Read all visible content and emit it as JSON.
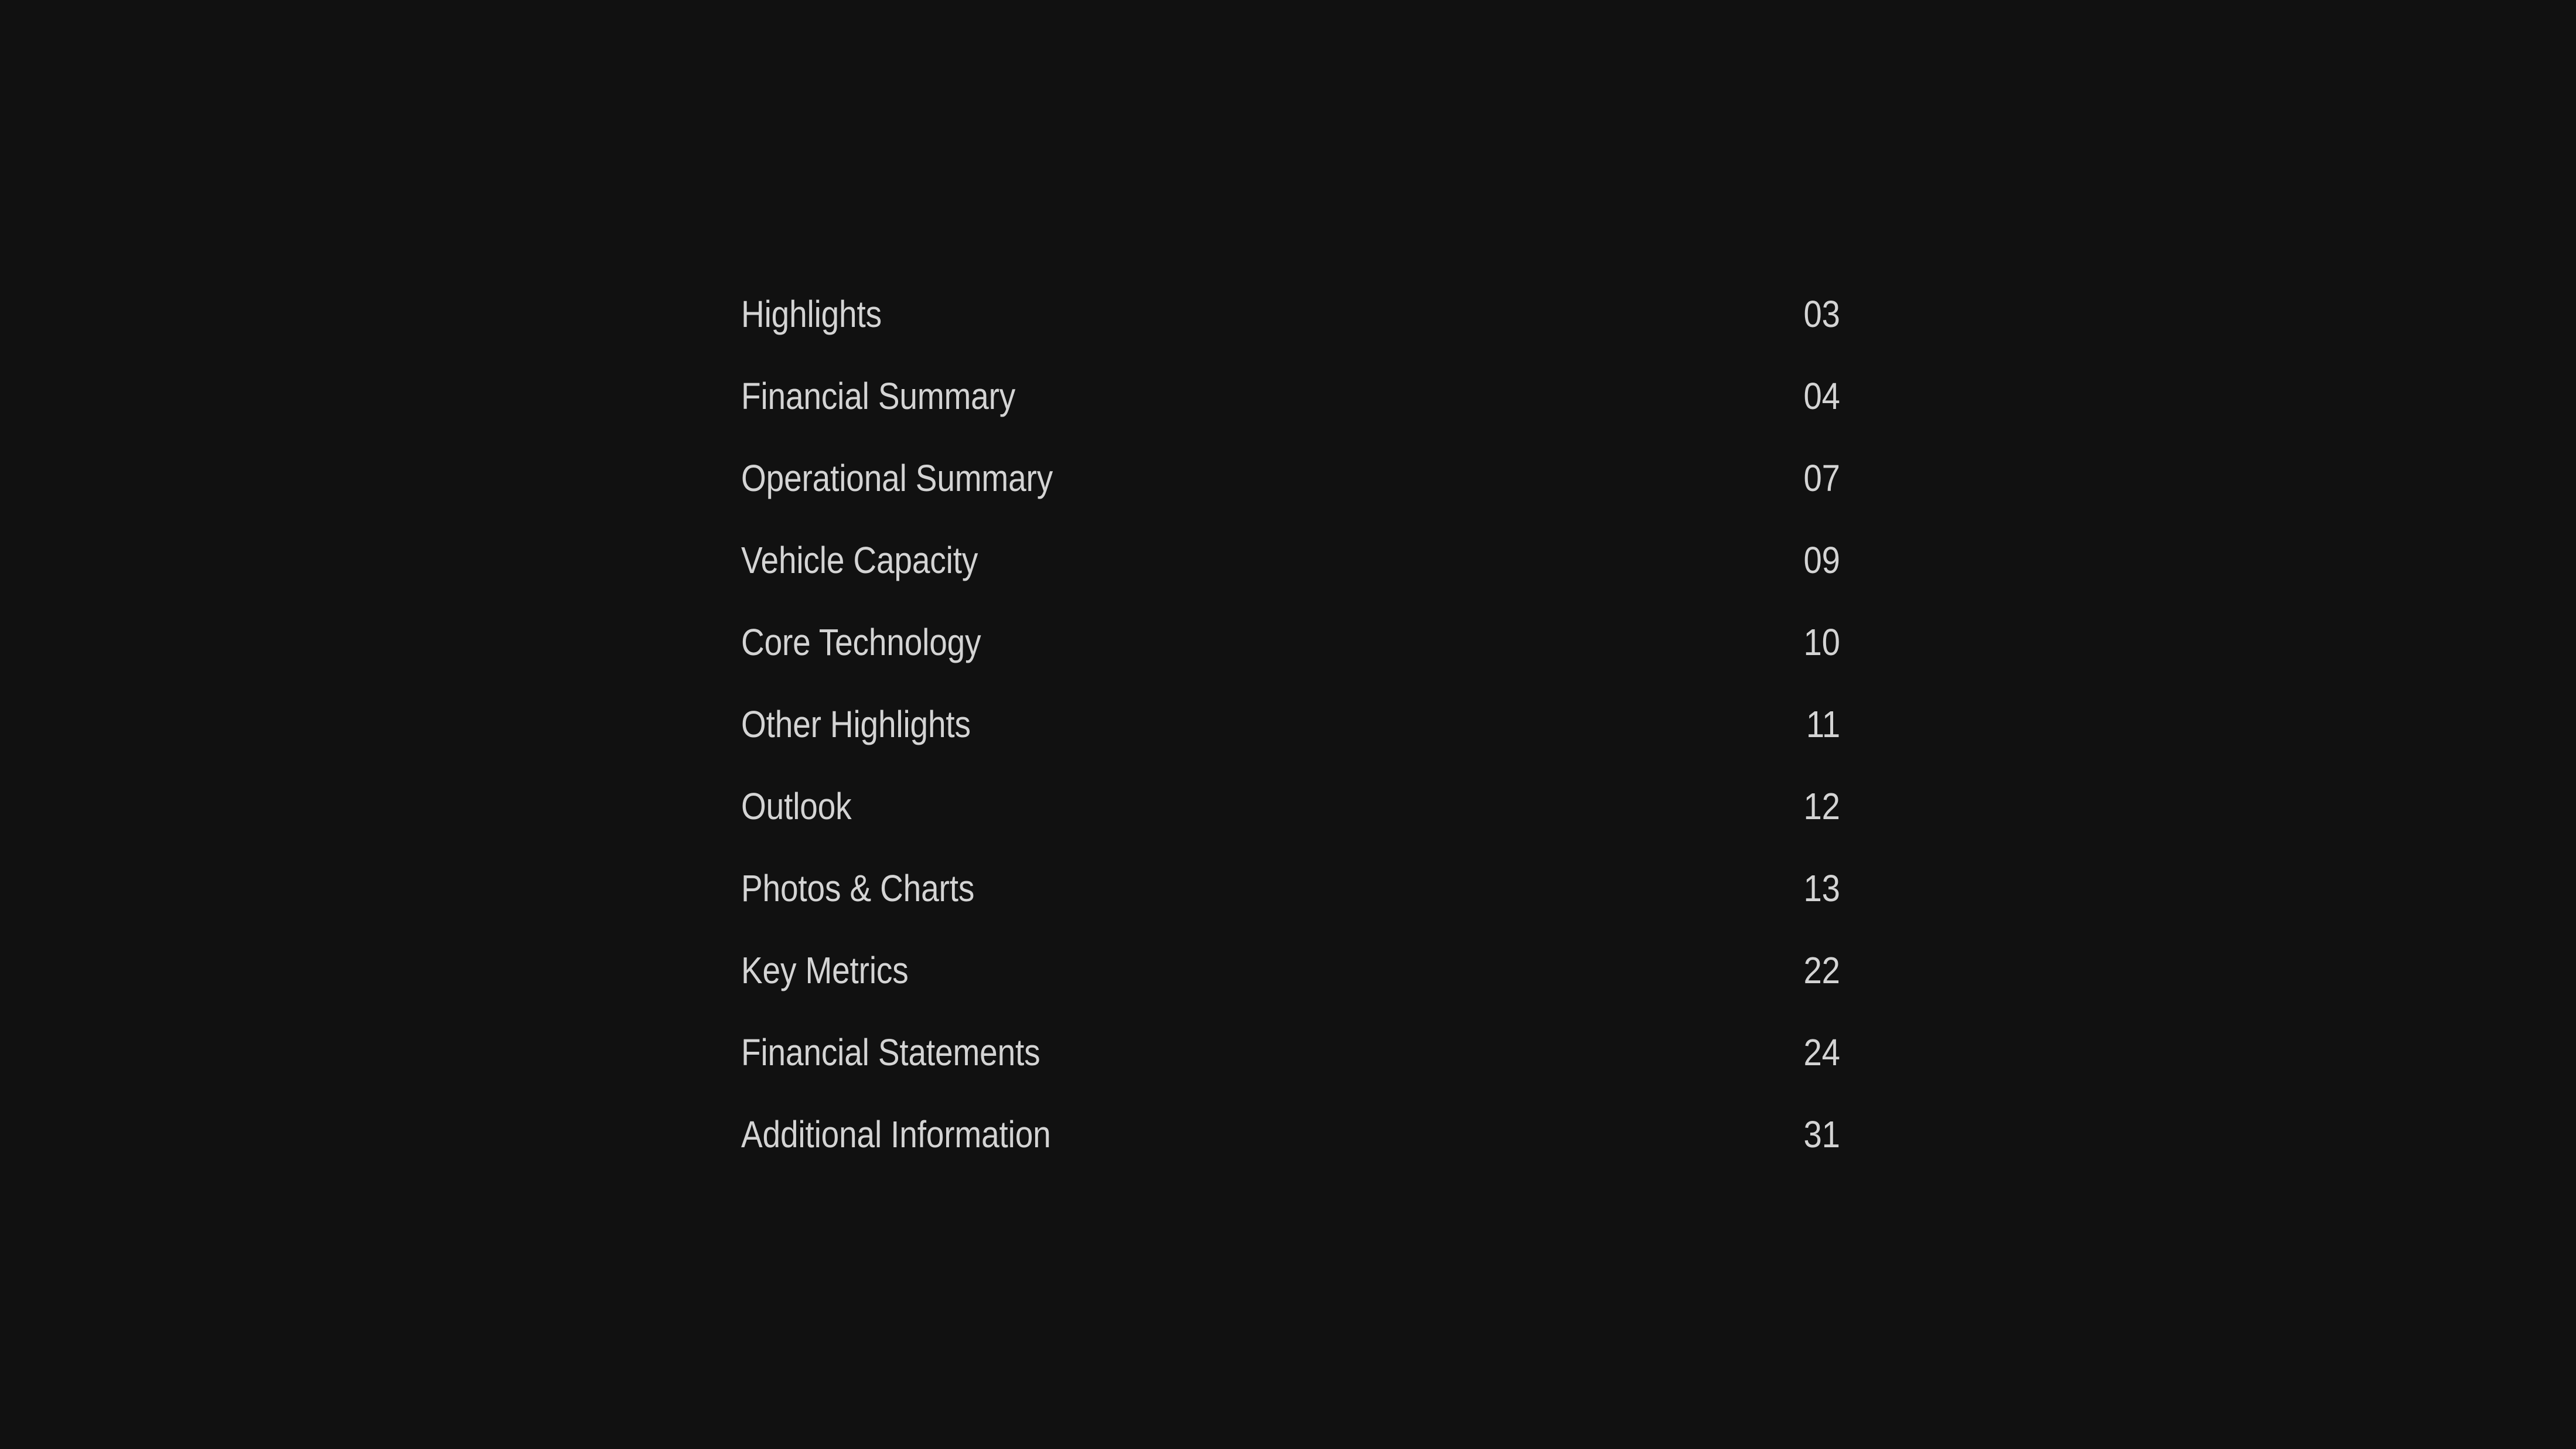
{
  "page": {
    "background_color": "#111111",
    "text_color": "#d4d4d4",
    "kind": "table-of-contents"
  },
  "toc": {
    "entries": [
      {
        "title": "Highlights",
        "page": "03"
      },
      {
        "title": "Financial Summary",
        "page": "04"
      },
      {
        "title": "Operational Summary",
        "page": "07"
      },
      {
        "title": "Vehicle Capacity",
        "page": "09"
      },
      {
        "title": "Core Technology",
        "page": "10"
      },
      {
        "title": "Other Highlights",
        "page": "11"
      },
      {
        "title": "Outlook",
        "page": "12"
      },
      {
        "title": "Photos & Charts",
        "page": "13"
      },
      {
        "title": "Key Metrics",
        "page": "22"
      },
      {
        "title": "Financial Statements",
        "page": "24"
      },
      {
        "title": "Additional Information",
        "page": "31"
      }
    ]
  }
}
